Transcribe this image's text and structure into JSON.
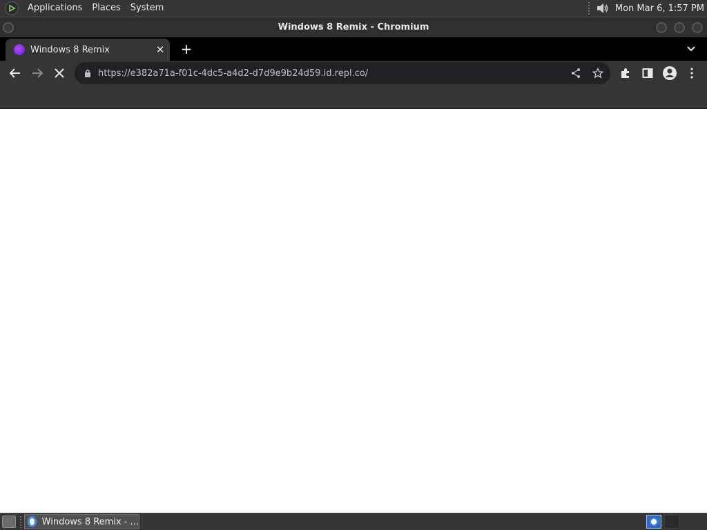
{
  "top_panel": {
    "menus": [
      "Applications",
      "Places",
      "System"
    ],
    "clock": "Mon Mar  6,  1:57 PM"
  },
  "window": {
    "title": "Windows 8 Remix - Chromium"
  },
  "browser": {
    "tab": {
      "title": "Windows 8 Remix",
      "close_symbol": "✕"
    },
    "new_tab_symbol": "+",
    "url": "https://e382a71a-f01c-4dc5-a4d2-d7d9e9b24d59.id.repl.co/"
  },
  "taskbar": {
    "task_title": "Windows 8 Remix - ..."
  },
  "colors": {
    "panel_bg": "#353535",
    "tab_strip_bg": "#000000",
    "omnibox_bg": "#202124",
    "page_bg": "#ffffff",
    "favicon": "#8a35f0"
  },
  "icons": {
    "panel_logo": "gnome-foot-icon",
    "volume": "speaker-icon",
    "favicon": "site-favicon-icon",
    "back": "arrow-left-icon",
    "forward": "arrow-right-icon",
    "stop": "close-icon",
    "lock": "lock-icon",
    "share": "share-icon",
    "bookmark": "star-icon",
    "extensions": "puzzle-icon",
    "side_panel": "side-panel-icon",
    "profile": "avatar-icon",
    "menu": "kebab-menu-icon",
    "tab_search": "chevron-down-icon"
  }
}
